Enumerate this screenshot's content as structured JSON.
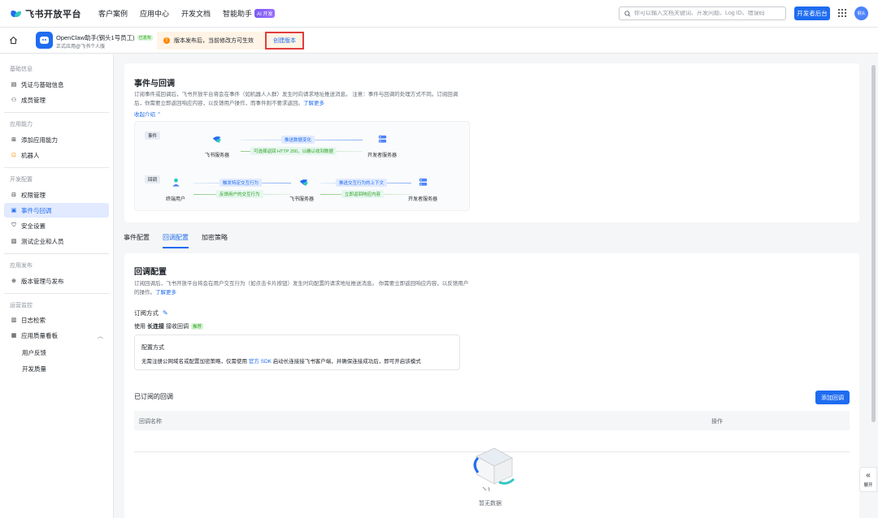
{
  "topnav": {
    "brand": "飞书开放平台",
    "items": [
      "客户案例",
      "应用中心",
      "开发文档",
      "智能助手"
    ],
    "ai_badge": "AI 开发",
    "search_placeholder": "你可以输入文档关键词、开发问题、Log ID、错误码",
    "dev_console": "开发者后台",
    "avatar_text": "钢头"
  },
  "subhead": {
    "app_name": "OpenClaw助手(钢头1号员工)",
    "status": "已发布",
    "app_sub": "正式应用@飞书个人版",
    "notice": "版本发布后，当前修改方可生效",
    "create_version": "创建版本"
  },
  "sidebar": {
    "sections": [
      {
        "title": "基础信息",
        "items": [
          "凭证与基础信息",
          "成员管理"
        ]
      },
      {
        "title": "应用能力",
        "items": [
          "添加应用能力",
          "机器人"
        ]
      },
      {
        "title": "开发配置",
        "items": [
          "权限管理",
          "事件与回调",
          "安全设置",
          "测试企业和人员"
        ]
      },
      {
        "title": "应用发布",
        "items": [
          "版本管理与发布"
        ]
      },
      {
        "title": "运营监控",
        "items": [
          "日志检索",
          "应用质量看板"
        ]
      }
    ],
    "subitems": [
      "用户反馈",
      "开发质量"
    ]
  },
  "events": {
    "title": "事件与回调",
    "desc": "订阅事件或回调后，飞书开放平台将会在事件（如机器人入群）发生时向请求地址推送消息。 注意：事件与回调的处理方式不同。订阅回调后，你需要立即返回响应内容，以反馈用户操作，而事件则不要求返回。",
    "learn_more": "了解更多",
    "collapse": "收起介绍",
    "diagram": {
      "tag_event": "事件",
      "tag_callback": "回调",
      "feishu_server": "飞书服务器",
      "dev_server": "开发者服务器",
      "end_user": "终端用户",
      "push_change": "推送数据变化",
      "return_http": "可选择返回 HTTP 200，以确认收到数据",
      "trigger_action": "触发特定交互行为",
      "feedback_action": "反馈用户的交互行为",
      "push_context": "推送交互行为的上下文",
      "return_response": "立即返回响应内容"
    }
  },
  "tabs": [
    "事件配置",
    "回调配置",
    "加密策略"
  ],
  "callback": {
    "title": "回调配置",
    "desc": "订阅回调后，飞书开放平台将会在用户交互行为（如点击卡片按钮）发生时向配置的请求地址推送消息。 你需要立即返回响应内容，以反馈用户的操作。",
    "learn_more": "了解更多",
    "sub_mode": "订阅方式",
    "use_prefix": "使用",
    "use_bold": "长连接",
    "use_suffix": "接收回调",
    "recommend": "推荐",
    "config_title": "配置方式",
    "config_desc_pre": "无需注册公网域名或配置加密策略，仅需使用",
    "config_link": "官方 SDK",
    "config_desc_post": "启动长连接接飞书客户端，并确保连接成功后，即可开启该模式",
    "subscribed": "已订阅的回调",
    "add": "添加回调",
    "col_name": "回调名称",
    "col_action": "操作",
    "empty": "暂无数据"
  },
  "expand_label": "展开"
}
